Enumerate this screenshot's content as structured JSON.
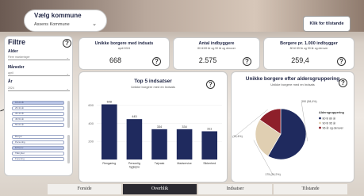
{
  "kommune": {
    "title": "Vælg kommune",
    "value": "Assens Kommune"
  },
  "help_button": "Klik for tilstande",
  "filters": {
    "title": "Filtre",
    "alder": {
      "label": "Alder",
      "value": "Flere markeringer"
    },
    "maaneder": {
      "label": "Måneder",
      "value": "april"
    },
    "aar": {
      "label": "År",
      "value": "2024"
    },
    "chips1": [
      "18-24 år",
      "25-34 år",
      "35-44 år",
      "45-54 år",
      "55-64 år"
    ],
    "chips2": [
      "Borger",
      "Personlig",
      "Erhverv",
      "Tilknyttet",
      "Forening"
    ]
  },
  "kpis": [
    {
      "title": "Unikke borgere med indsats",
      "sub": "april 2024",
      "value": "668"
    },
    {
      "title": "Antal indbyggere",
      "sub": "80 til 89 år og 90 år og derover",
      "value": "2.575"
    },
    {
      "title": "Borgere pr. 1.000 indbygger",
      "sub": "80 til 89 år og 90 år og derover",
      "value": "259,4"
    }
  ],
  "chart_data": [
    {
      "type": "bar",
      "title": "Top 5 indsatser",
      "subtitle": "Unikke borgere med en Indsats",
      "categories": [
        "Rengøring",
        "Personlig hygiejne",
        "Tøjvask",
        "Madservice",
        "Sikkerhed"
      ],
      "values": [
        608,
        445,
        334,
        334,
        311
      ],
      "ylim": [
        0,
        700
      ],
      "yticks": [
        200,
        400,
        600
      ],
      "color": "#1f2a5e"
    },
    {
      "type": "pie",
      "title": "Unikke borgere efter aldersgruppering",
      "subtitle": "Unikke borgere med en Indsats",
      "categories": [
        "80 til 89 år",
        "90 til 95 år",
        "96 år og derover"
      ],
      "values": [
        390,
        175,
        103
      ],
      "data_labels": [
        "390 (58,4%)",
        "175 (26,2%)",
        "103 (15,4%)"
      ],
      "legend_title": "Aldersgruppering",
      "colors": [
        "#1f2a5e",
        "#e0cfb2",
        "#8e1f2a",
        "#6b2a4f"
      ]
    }
  ],
  "nav": {
    "tabs": [
      "Forside",
      "Overblik",
      "Indsatser",
      "Tilstande"
    ],
    "active": 1
  }
}
